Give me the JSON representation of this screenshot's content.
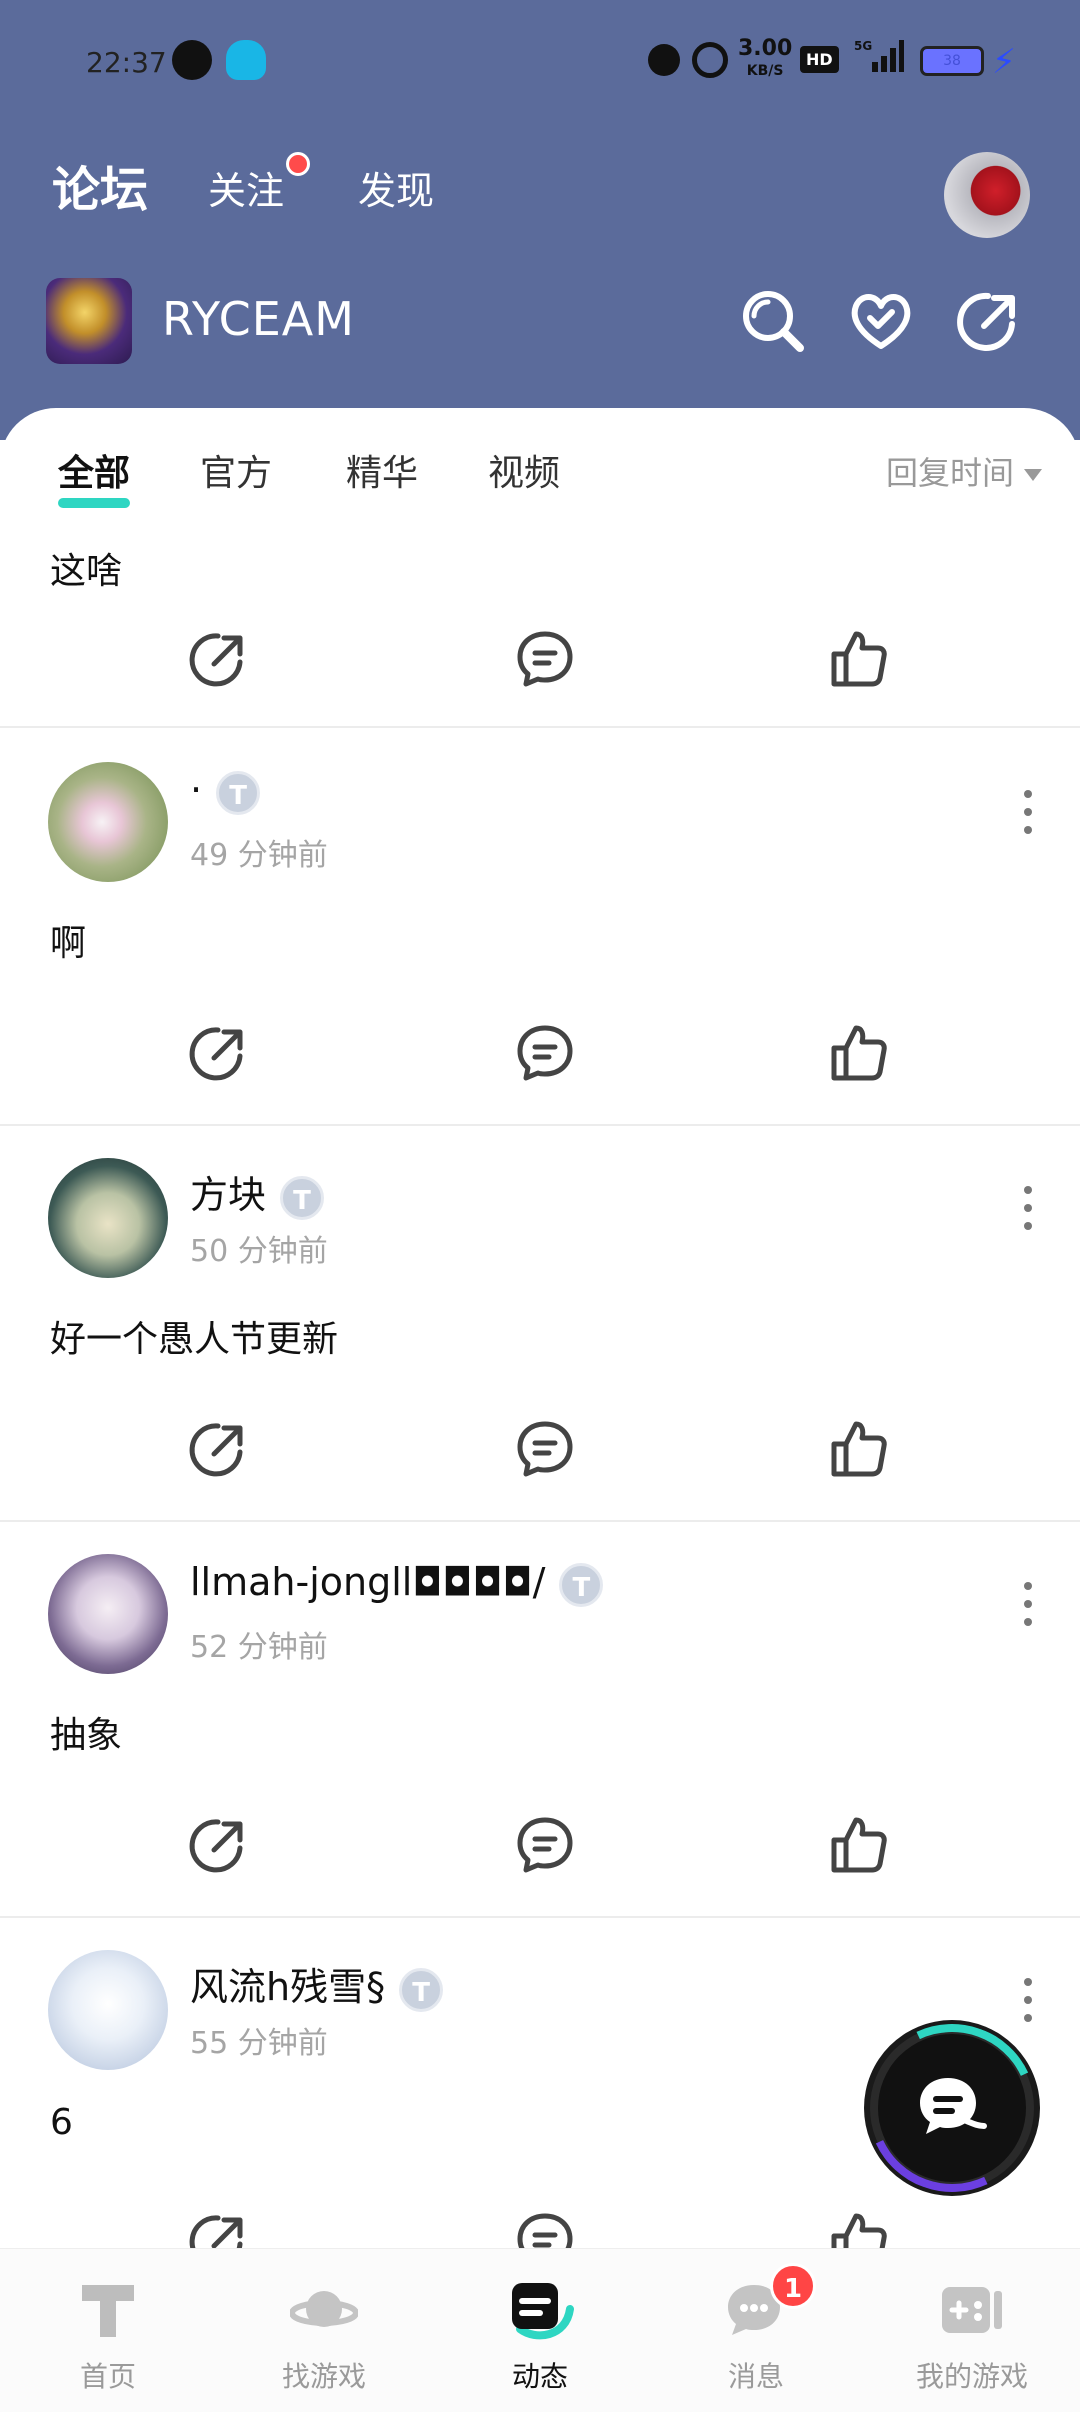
{
  "status_bar": {
    "time": "22:37",
    "speed_value": "3.00",
    "speed_unit": "KB/S",
    "hd": "HD",
    "network": "5G",
    "battery": "38"
  },
  "top_nav": {
    "tabs": [
      "论坛",
      "关注",
      "发现"
    ]
  },
  "forum": {
    "name": "RYCEAM"
  },
  "sub_tabs": {
    "items": [
      "全部",
      "官方",
      "精华",
      "视频"
    ],
    "sort_label": "回复时间"
  },
  "first_post": {
    "text": "这啥"
  },
  "posts": [
    {
      "name": "·",
      "badge": "T",
      "time": "49 分钟前",
      "text": "啊"
    },
    {
      "name": "方块",
      "badge": "T",
      "time": "50 分钟前",
      "text": "好一个愚人节更新"
    },
    {
      "name": "llmah-jongll◘◘◘◘/",
      "badge": "T",
      "time": "52 分钟前",
      "text": "抽象"
    },
    {
      "name": "风流h残雪§",
      "badge": "T",
      "time": "55 分钟前",
      "text": "6"
    }
  ],
  "bottom_nav": {
    "items": [
      "首页",
      "找游戏",
      "动态",
      "消息",
      "我的游戏"
    ],
    "message_badge": "1"
  },
  "colors": {
    "header_bg": "#5b6b9b",
    "accent": "#2ed6c2",
    "badge_red": "#ff4545"
  },
  "icons": [
    "search-icon",
    "heart-check-icon",
    "share-icon",
    "comment-icon",
    "like-icon",
    "more-icon"
  ]
}
